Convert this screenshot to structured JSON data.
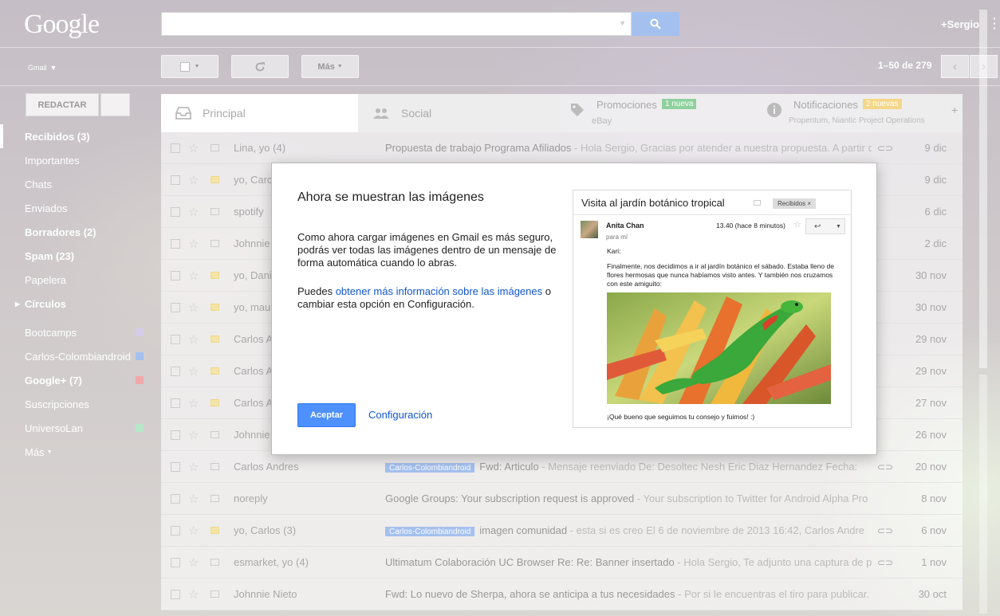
{
  "header": {
    "logo": "Google",
    "user": "+Sergio"
  },
  "toolbar": {
    "app_label": "Gmail",
    "more_label": "Más",
    "pager": "1–50 de 279"
  },
  "sidebar": {
    "compose_label": "REDACTAR",
    "items": [
      {
        "label": "Recibidos (3)"
      },
      {
        "label": "Importantes"
      },
      {
        "label": "Chats"
      },
      {
        "label": "Enviados"
      },
      {
        "label": "Borradores (2)"
      },
      {
        "label": "Spam (23)"
      },
      {
        "label": "Papelera"
      },
      {
        "label": "Círculos"
      },
      {
        "label": "Bootcamps",
        "color": "#d3cdea"
      },
      {
        "label": "Carlos-Colombiandroid",
        "color": "#a4c0ee"
      },
      {
        "label": "Google+ (7)",
        "color": "#f0a9a9"
      },
      {
        "label": "Suscripciones"
      },
      {
        "label": "UniversoLan",
        "color": "#b7e6c9"
      },
      {
        "label": "Más"
      }
    ]
  },
  "tabs": [
    {
      "label": "Principal"
    },
    {
      "label": "Social"
    },
    {
      "label": "Promociones",
      "badge": "1 nueva",
      "sub": "eBay",
      "badge_color": "#8fd19e"
    },
    {
      "label": "Notificaciones",
      "badge": "2 nuevas",
      "sub": "Propentum, Niantic Project Operations",
      "badge_color": "#f5d78a"
    }
  ],
  "emails": [
    {
      "from": "Lina, yo (4)",
      "subject": "Propuesta de trabajo Programa Afiliados",
      "preview": " - Hola Sergio, Gracias por atender a nuestra propuesta. A partir d",
      "date": "9 dic",
      "clip": true,
      "imp": false
    },
    {
      "from": "yo, Carc",
      "subject": "",
      "preview": "",
      "date": "9 dic",
      "imp": true
    },
    {
      "from": "spotify",
      "subject": "",
      "preview": "",
      "date": "6 dic",
      "imp": false
    },
    {
      "from": "Johnnie",
      "subject": "",
      "preview": "",
      "date": "2 dic",
      "imp": false
    },
    {
      "from": "yo, Dani",
      "subject": "",
      "preview": "",
      "date": "30 nov",
      "imp": true
    },
    {
      "from": "yo, mau",
      "subject": "",
      "preview": "",
      "date": "30 nov",
      "imp": true
    },
    {
      "from": "Carlos A",
      "subject": "",
      "preview": "",
      "date": "29 nov",
      "imp": true
    },
    {
      "from": "Carlos A",
      "subject": "",
      "preview": "",
      "date": "29 nov",
      "imp": true
    },
    {
      "from": "Carlos A",
      "subject": "",
      "preview": "",
      "date": "27 nov",
      "imp": true
    },
    {
      "from": "Johnnie",
      "subject": "",
      "preview": "",
      "date": "26 nov",
      "imp": false
    },
    {
      "from": "Carlos Andres",
      "label": "Carlos-Colombiandroid",
      "subject": "Fwd: Articulo",
      "preview": " - Mensaje reenviado De: Desoltec Nesh Eric Diaz Hernandez Fecha:",
      "date": "20 nov",
      "clip": true,
      "imp": false
    },
    {
      "from": "noreply",
      "subject": "Google Groups: Your subscription request is approved",
      "preview": " - Your subscription to Twitter for Android Alpha Pro",
      "date": "8 nov",
      "imp": false
    },
    {
      "from": "yo, Carlos (3)",
      "label": "Carlos-Colombiandroid",
      "subject": "imagen comunidad",
      "preview": " - esta si es creo El 6 de noviembre de 2013 16:42, Carlos Andre",
      "date": "6 nov",
      "clip": true,
      "imp": true
    },
    {
      "from": "esmarket, yo (4)",
      "subject": "Ultimatum Colaboración UC Browser Re: Re: Banner insertado",
      "preview": " - Hola Sergio, Te adjunto una captura de p",
      "date": "1 nov",
      "clip": true,
      "imp": false
    },
    {
      "from": "Johnnie Nieto",
      "subject": "Fwd: Lo nuevo de Sherpa, ahora se anticipa a tus necesidades",
      "preview": " - Por si le encuentras el tiro para publicar.",
      "date": "30 oct",
      "imp": false
    }
  ],
  "modal": {
    "title": "Ahora se muestran las imágenes",
    "p1": "Como ahora cargar imágenes en Gmail es más seguro, podrás ver todas las imágenes dentro de un mensaje de forma automática cuando lo abras.",
    "p2_before": "Puedes ",
    "p2_link": "obtener más información sobre las imágenes",
    "p2_after": " o cambiar esta opción en Configuración.",
    "accept_label": "Aceptar",
    "config_label": "Configuración",
    "preview": {
      "title": "Visita al jardín botánico tropical",
      "tag": "Recibidos",
      "tag_close": "×",
      "sender": "Anita Chan",
      "to": "para mí",
      "time": "13.40 (hace 8 minutos)",
      "greeting": "Kari:",
      "body": "Finalmente, nos decidimos a ir al jardín botánico el sábado. Estaba lleno de flores hermosas que nunca habíamos visto antes. Y también nos cruzamos con este amiguito:",
      "closing": "¡Qué bueno que seguimos tu consejo y fuimos! :)"
    }
  }
}
